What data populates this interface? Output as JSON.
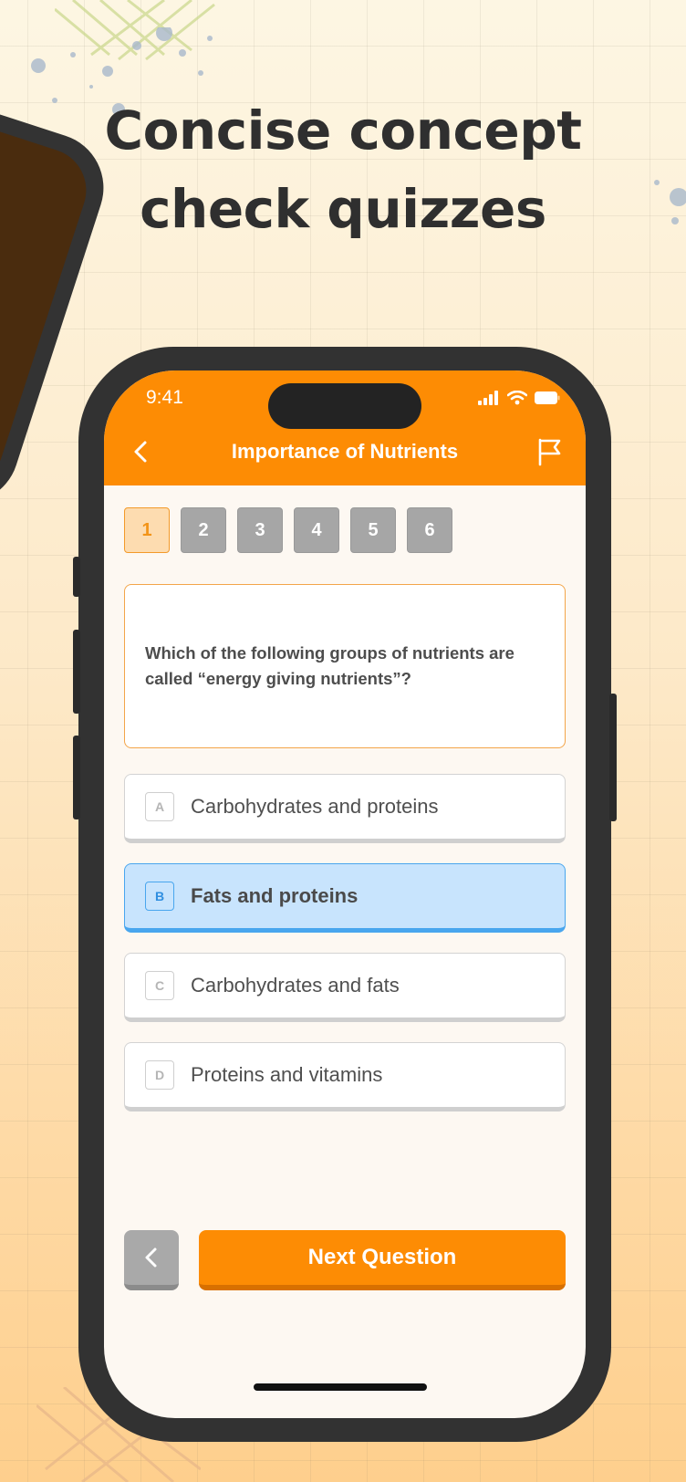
{
  "headline": {
    "line1": "Concise concept",
    "line2": "check quizzes"
  },
  "status_bar": {
    "time": "9:41"
  },
  "nav": {
    "title": "Importance of Nutrients"
  },
  "question_numbers": [
    "1",
    "2",
    "3",
    "4",
    "5",
    "6"
  ],
  "active_question": "1",
  "question": {
    "text": "Which of the following groups of nutrients are called “energy giving nutrients”?"
  },
  "options": [
    {
      "letter": "A",
      "text": "Carbohydrates and proteins",
      "selected": false
    },
    {
      "letter": "B",
      "text": "Fats and proteins",
      "selected": true
    },
    {
      "letter": "C",
      "text": "Carbohydrates and fats",
      "selected": false
    },
    {
      "letter": "D",
      "text": "Proteins and vitamins",
      "selected": false
    }
  ],
  "footer": {
    "next_label": "Next Question"
  },
  "colors": {
    "accent": "#fd8c04",
    "selected": "#c8e4fd",
    "selected_border": "#49a6ee"
  }
}
